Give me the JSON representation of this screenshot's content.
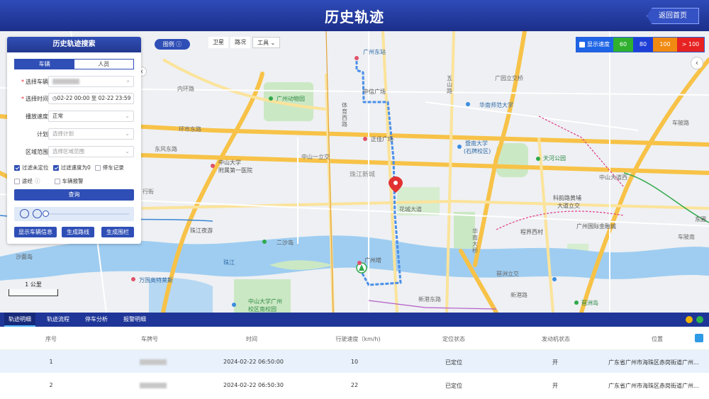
{
  "header": {
    "title": "历史轨迹",
    "back_label": "返回首页"
  },
  "map_toolbar": {
    "legend_label": "图例",
    "satellite": "卫星",
    "traffic": "路况",
    "tools": "工具"
  },
  "speed_legend": {
    "label": "显示速度",
    "items": [
      {
        "label": "60",
        "color": "#2fb02f"
      },
      {
        "label": "80",
        "color": "#1e3fd6"
      },
      {
        "label": "100",
        "color": "#f08a12"
      },
      {
        "label": "> 100",
        "color": "#e62222"
      }
    ]
  },
  "map": {
    "labels": [
      "广州东站",
      "中信广场",
      "广州动物园",
      "体育西路",
      "正佳广场",
      "暨南大学",
      "(石牌校区)",
      "华南师范大学",
      "天河公园",
      "广园立交桥",
      "五山路",
      "内环路",
      "环市东路",
      "东风东路",
      "中山一立交",
      "中山大学",
      "附属第一医院",
      "珠江新城",
      "花城大道",
      "中山大道西",
      "科韵路黄埔",
      "大道立交",
      "广州国际金融城",
      "程界西村",
      "二沙岛",
      "广州塔",
      "华南大桥",
      "琶洲立交",
      "新港东路",
      "万国奥特莱斯",
      "中山大学广州",
      "校区南校园",
      "珠江夜游",
      "沙面岛",
      "珠江",
      "新港路",
      "琶洲岛",
      "车陂路",
      "东圃",
      "行街",
      "车陂南"
    ],
    "scale": "1 公里"
  },
  "search_panel": {
    "title": "历史轨迹搜索",
    "tabs": [
      "车辆",
      "人员"
    ],
    "vehicle_label": "选择车辆",
    "time_label": "选择时间",
    "time_value": "02-22 00:00  至  02-22 23:59",
    "speed_label": "播放速度",
    "speed_value": "正常",
    "plan_label": "计划",
    "plan_placeholder": "选择计划",
    "area_label": "区域范围",
    "area_placeholder": "选择区域范围",
    "checks": [
      {
        "label": "过滤未定位",
        "checked": true
      },
      {
        "label": "过滤速度为0",
        "checked": true
      },
      {
        "label": "停车记录",
        "checked": false
      },
      {
        "label": "途经",
        "checked": false
      },
      {
        "label": "车辆报警",
        "checked": false
      }
    ],
    "query_label": "查询",
    "actions": [
      "显示车辆信息",
      "生成路线",
      "生成围栏"
    ]
  },
  "detail": {
    "tabs": [
      "轨迹明细",
      "轨迹流程",
      "停车分析",
      "报警明细"
    ],
    "columns": [
      "序号",
      "车牌号",
      "时间",
      "行驶速度（km/h)",
      "定位状态",
      "发动机状态",
      "位置"
    ],
    "rows": [
      {
        "no": "1",
        "time": "2024-02-22 06:50:00",
        "speed": "10",
        "loc": "已定位",
        "engine": "开",
        "address": "广东省广州市海珠区赤岗街道广州..."
      },
      {
        "no": "2",
        "time": "2024-02-22 06:50:30",
        "speed": "22",
        "loc": "已定位",
        "engine": "开",
        "address": "广东省广州市海珠区赤岗街道广州..."
      }
    ]
  }
}
